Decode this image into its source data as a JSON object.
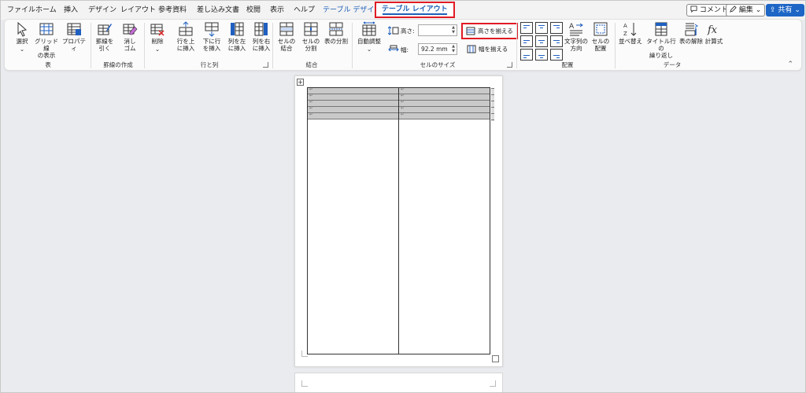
{
  "tabs": {
    "file": "ファイル",
    "home": "ホーム",
    "insert": "挿入",
    "design": "デザイン",
    "layout": "レイアウト",
    "references": "参考資料",
    "mailings": "差し込み文書",
    "review": "校閲",
    "view": "表示",
    "help": "ヘルプ",
    "table_design": "テーブル デザイン",
    "table_layout": "テーブル レイアウト"
  },
  "titlebar_buttons": {
    "comments": "コメント",
    "editing": "編集",
    "share": "共有"
  },
  "ribbon": {
    "table_group": {
      "label": "表",
      "select": "選択",
      "gridlines": "グリッド線\nの表示",
      "properties": "プロパティ"
    },
    "draw_group": {
      "label": "罫線の作成",
      "draw_table": "罫線を\n引く",
      "eraser": "消し\nゴム"
    },
    "rows_cols_group": {
      "label": "行と列",
      "delete": "削除",
      "insert_above": "行を上\nに挿入",
      "insert_below": "下に行\nを挿入",
      "insert_left": "列を左\nに挿入",
      "insert_right": "列を右\nに挿入"
    },
    "merge_group": {
      "label": "結合",
      "merge_cells": "セルの\n結合",
      "split_cells": "セルの\n分割",
      "split_table": "表の分割"
    },
    "cell_size_group": {
      "label": "セルのサイズ",
      "autofit": "自動調整",
      "height_label": "高さ:",
      "height_value": "",
      "width_label": "幅:",
      "width_value": "92.2 mm",
      "distribute_rows": "高さを揃える",
      "distribute_cols": "幅を揃える"
    },
    "alignment_group": {
      "label": "配置",
      "text_direction": "文字列の\n方向",
      "cell_margins": "セルの\n配置"
    },
    "data_group": {
      "label": "データ",
      "sort": "並べ替え",
      "repeat_header": "タイトル行の\n繰り返し",
      "convert_to_text": "表の解除",
      "formula": "計算式"
    }
  },
  "colors": {
    "accent_blue": "#1d5fb8",
    "highlight_red": "#e01b24",
    "share_blue": "#1d66c6"
  },
  "icons": [
    "select-icon",
    "gridlines-icon",
    "properties-icon",
    "draw-table-icon",
    "eraser-icon",
    "delete-icon",
    "insert-above-icon",
    "insert-below-icon",
    "insert-left-icon",
    "insert-right-icon",
    "merge-cells-icon",
    "split-cells-icon",
    "split-table-icon",
    "autofit-icon",
    "text-direction-icon",
    "cell-margins-icon",
    "sort-icon",
    "repeat-header-icon",
    "convert-to-text-icon",
    "formula-icon",
    "comment-icon",
    "pen-icon"
  ]
}
